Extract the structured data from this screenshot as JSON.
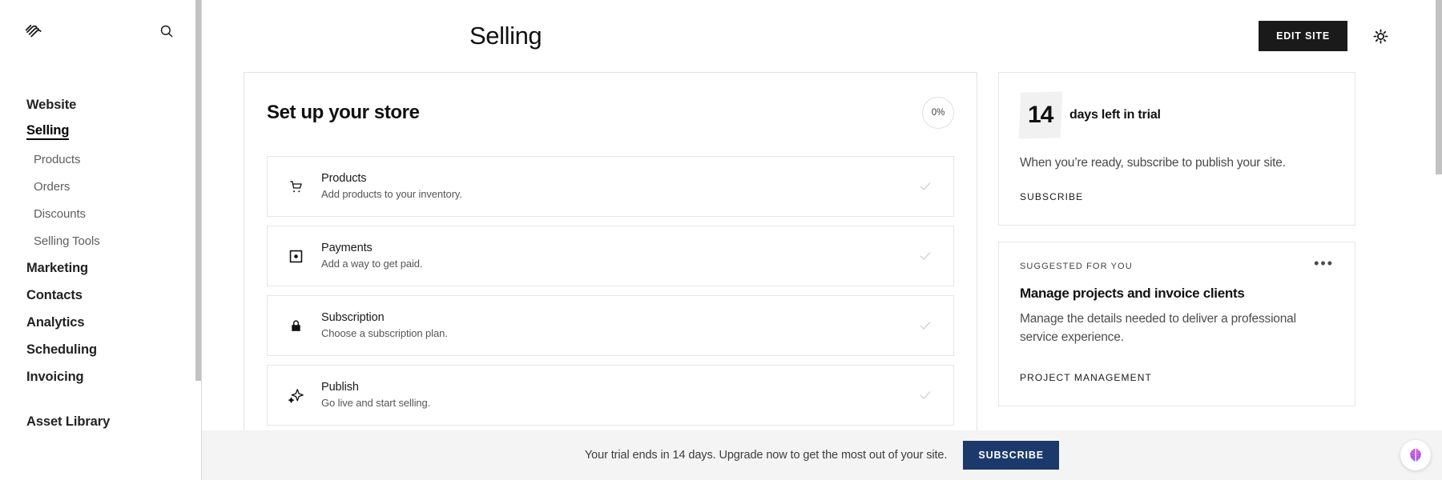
{
  "sidebar": {
    "logo_icon": "squarespace-logo",
    "search_icon": "search-icon",
    "items": [
      {
        "label": "Website",
        "type": "top",
        "active": false
      },
      {
        "label": "Selling",
        "type": "top",
        "active": true
      },
      {
        "label": "Products",
        "type": "sub",
        "active": false
      },
      {
        "label": "Orders",
        "type": "sub",
        "active": false
      },
      {
        "label": "Discounts",
        "type": "sub",
        "active": false
      },
      {
        "label": "Selling Tools",
        "type": "sub",
        "active": false
      },
      {
        "label": "Marketing",
        "type": "top",
        "active": false
      },
      {
        "label": "Contacts",
        "type": "top",
        "active": false
      },
      {
        "label": "Analytics",
        "type": "top",
        "active": false
      },
      {
        "label": "Scheduling",
        "type": "top",
        "active": false
      },
      {
        "label": "Invoicing",
        "type": "top",
        "active": false
      },
      {
        "label": "Asset Library",
        "type": "top",
        "active": false
      }
    ]
  },
  "header": {
    "title": "Selling",
    "edit_site_label": "EDIT SITE",
    "gear_icon": "gear-icon"
  },
  "setup": {
    "title": "Set up your store",
    "progress_label": "0%",
    "progress_value": 0,
    "tasks": [
      {
        "icon": "shopping-cart-icon",
        "title": "Products",
        "desc": "Add products to your inventory.",
        "check_icon": "checkmark-icon"
      },
      {
        "icon": "payment-card-icon",
        "title": "Payments",
        "desc": "Add a way to get paid.",
        "check_icon": "checkmark-icon"
      },
      {
        "icon": "lock-icon",
        "title": "Subscription",
        "desc": "Choose a subscription plan.",
        "check_icon": "checkmark-icon"
      },
      {
        "icon": "sparkle-icon",
        "title": "Publish",
        "desc": "Go live and start selling.",
        "check_icon": "checkmark-icon"
      }
    ]
  },
  "trial_card": {
    "days": "14",
    "days_label": "days left in trial",
    "body": "When you’re ready, subscribe to publish your site.",
    "subscribe_label": "SUBSCRIBE"
  },
  "suggested_card": {
    "eyebrow": "SUGGESTED FOR YOU",
    "menu_icon": "ellipsis-icon",
    "menu_label": "•••",
    "title": "Manage projects and invoice clients",
    "desc": "Manage the details needed to deliver a professional service experience.",
    "cta_label": "PROJECT MANAGEMENT"
  },
  "banner": {
    "text": "Your trial ends in 14 days. Upgrade now to get the most out of your site.",
    "button_label": "SUBSCRIBE"
  },
  "fab": {
    "icon": "ai-brain-icon"
  },
  "colors": {
    "accent_dark": "#1a1a1a",
    "banner_button": "#1b3a6b",
    "banner_bg": "#f4f4f4",
    "border": "#e6e6e6",
    "muted_text": "#565656",
    "check": "#c9c9c9"
  }
}
